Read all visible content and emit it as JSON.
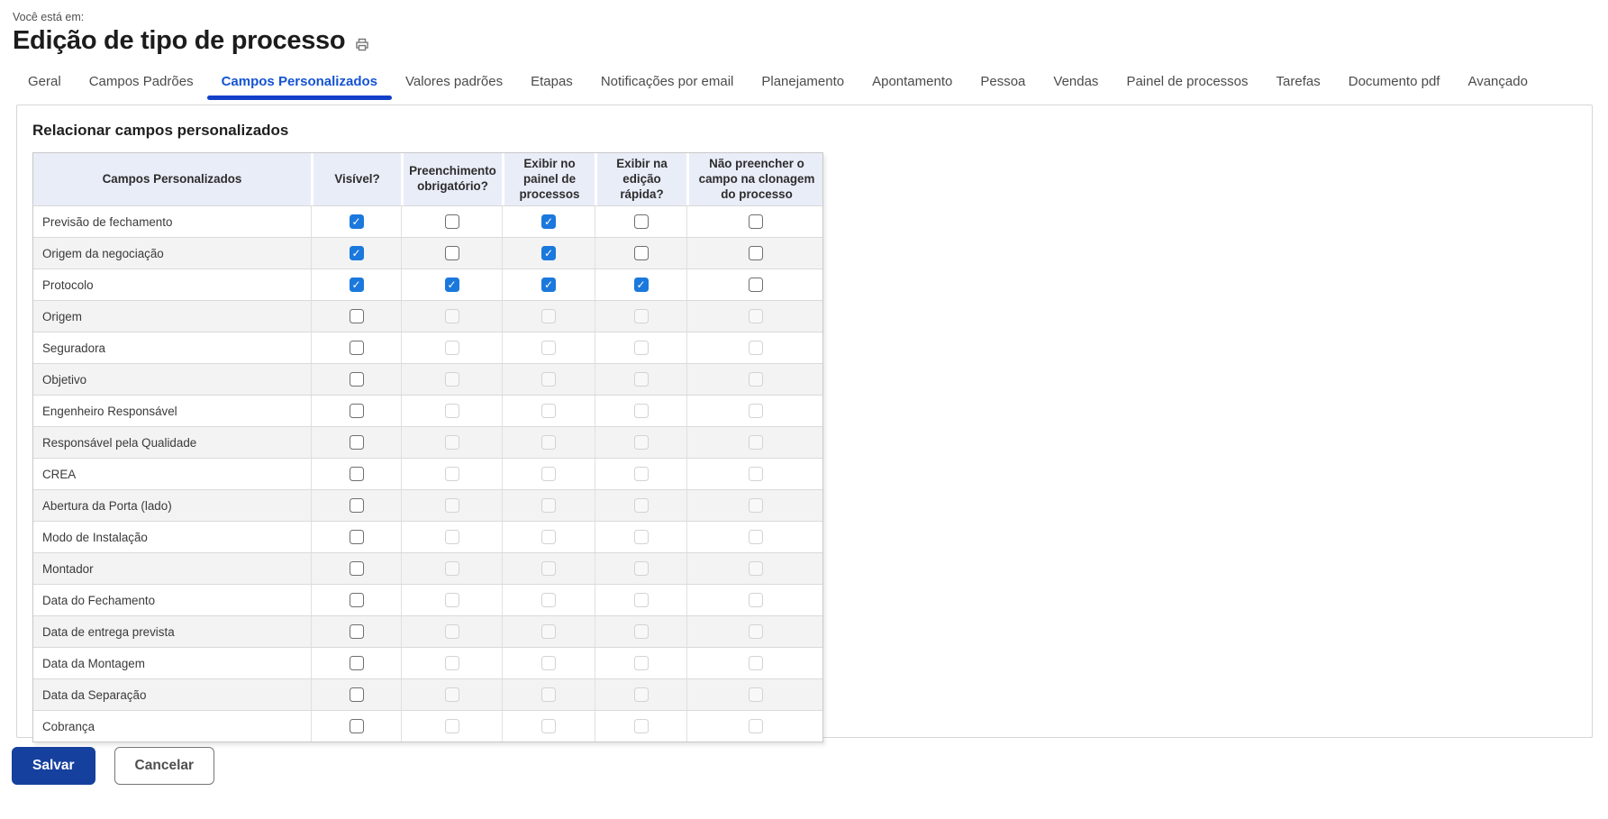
{
  "breadcrumb": "Você está em:",
  "page": {
    "title": "Edição de tipo de processo"
  },
  "tabs": [
    {
      "label": "Geral",
      "active": false
    },
    {
      "label": "Campos Padrões",
      "active": false
    },
    {
      "label": "Campos Personalizados",
      "active": true
    },
    {
      "label": "Valores padrões",
      "active": false
    },
    {
      "label": "Etapas",
      "active": false
    },
    {
      "label": "Notificações por email",
      "active": false
    },
    {
      "label": "Planejamento",
      "active": false
    },
    {
      "label": "Apontamento",
      "active": false
    },
    {
      "label": "Pessoa",
      "active": false
    },
    {
      "label": "Vendas",
      "active": false
    },
    {
      "label": "Painel de processos",
      "active": false
    },
    {
      "label": "Tarefas",
      "active": false
    },
    {
      "label": "Documento pdf",
      "active": false
    },
    {
      "label": "Avançado",
      "active": false
    }
  ],
  "section": {
    "heading": "Relacionar campos personalizados"
  },
  "table": {
    "headers": [
      "Campos Personalizados",
      "Visível?",
      "Preenchimento obrigatório?",
      "Exibir no painel de processos",
      "Exibir na edição rápida?",
      "Não preencher o campo na clonagem do processo"
    ],
    "rows": [
      {
        "label": "Previsão de fechamento",
        "checks": [
          "checked",
          "unchecked",
          "checked",
          "unchecked",
          "unchecked"
        ]
      },
      {
        "label": "Origem da negociação",
        "checks": [
          "checked",
          "unchecked",
          "checked",
          "unchecked",
          "unchecked"
        ]
      },
      {
        "label": "Protocolo",
        "checks": [
          "checked",
          "checked",
          "checked",
          "checked",
          "unchecked"
        ]
      },
      {
        "label": "Origem",
        "checks": [
          "unchecked",
          "disabled",
          "disabled",
          "disabled",
          "disabled"
        ]
      },
      {
        "label": "Seguradora",
        "checks": [
          "unchecked",
          "disabled",
          "disabled",
          "disabled",
          "disabled"
        ]
      },
      {
        "label": "Objetivo",
        "checks": [
          "unchecked",
          "disabled",
          "disabled",
          "disabled",
          "disabled"
        ]
      },
      {
        "label": "Engenheiro Responsável",
        "checks": [
          "unchecked",
          "disabled",
          "disabled",
          "disabled",
          "disabled"
        ]
      },
      {
        "label": "Responsável pela Qualidade",
        "checks": [
          "unchecked",
          "disabled",
          "disabled",
          "disabled",
          "disabled"
        ]
      },
      {
        "label": "CREA",
        "checks": [
          "unchecked",
          "disabled",
          "disabled",
          "disabled",
          "disabled"
        ]
      },
      {
        "label": "Abertura da Porta (lado)",
        "checks": [
          "unchecked",
          "disabled",
          "disabled",
          "disabled",
          "disabled"
        ]
      },
      {
        "label": "Modo de Instalação",
        "checks": [
          "unchecked",
          "disabled",
          "disabled",
          "disabled",
          "disabled"
        ]
      },
      {
        "label": "Montador",
        "checks": [
          "unchecked",
          "disabled",
          "disabled",
          "disabled",
          "disabled"
        ]
      },
      {
        "label": "Data do Fechamento",
        "checks": [
          "unchecked",
          "disabled",
          "disabled",
          "disabled",
          "disabled"
        ]
      },
      {
        "label": "Data de entrega prevista",
        "checks": [
          "unchecked",
          "disabled",
          "disabled",
          "disabled",
          "disabled"
        ]
      },
      {
        "label": "Data da Montagem",
        "checks": [
          "unchecked",
          "disabled",
          "disabled",
          "disabled",
          "disabled"
        ]
      },
      {
        "label": "Data da Separação",
        "checks": [
          "unchecked",
          "disabled",
          "disabled",
          "disabled",
          "disabled"
        ]
      },
      {
        "label": "Cobrança",
        "checks": [
          "unchecked",
          "disabled",
          "disabled",
          "disabled",
          "disabled"
        ]
      }
    ],
    "check_glyph": "✓"
  },
  "buttons": {
    "save": "Salvar",
    "cancel": "Cancelar"
  },
  "icons": {
    "print": "printer-icon"
  },
  "colors": {
    "accent": "#1554d2",
    "accent-underline": "#1240c8",
    "checkbox-blue": "#1b78dc",
    "save-bg": "#15409e",
    "header-bg": "#e9edf8"
  }
}
